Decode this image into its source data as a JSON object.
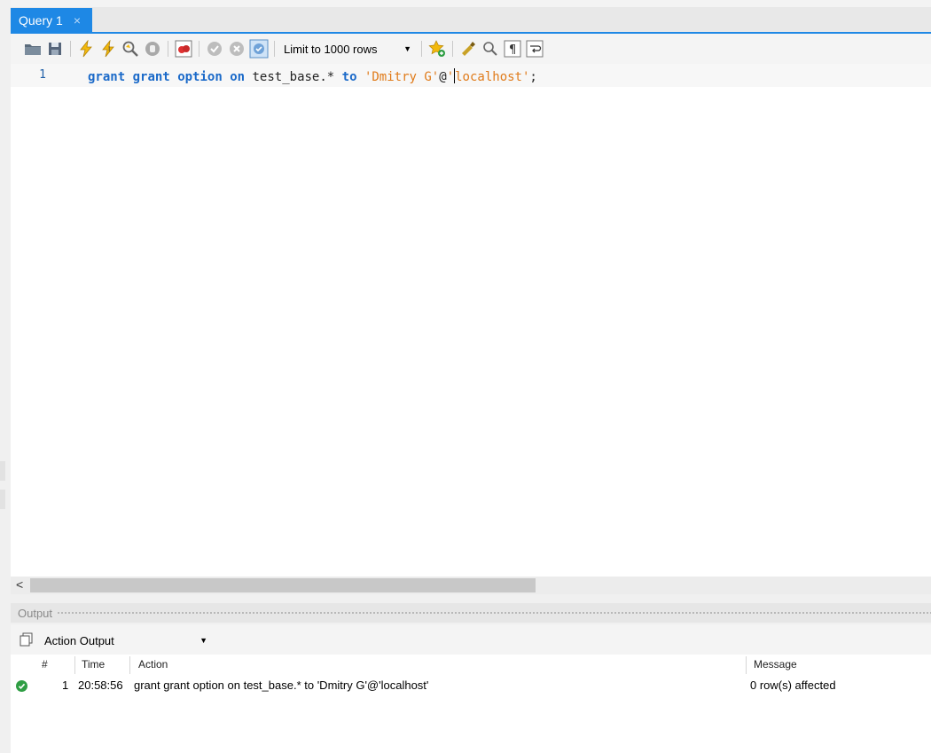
{
  "tabs": [
    {
      "label": "Query 1",
      "close": "×",
      "active": true
    }
  ],
  "toolbar": {
    "limit_select": {
      "value": "Limit to 1000 rows"
    }
  },
  "editor": {
    "line_number": "1",
    "tokens": {
      "t1": "grant",
      "t2": "grant",
      "t3": "option",
      "t4": "on",
      "t5": "test_base.*",
      "t6": "to",
      "t7": "'Dmitry G'",
      "t8": "@",
      "t9": "'",
      "t10": "localhost'",
      "t11": ";"
    }
  },
  "output": {
    "title": "Output",
    "view_select": {
      "value": "Action Output"
    },
    "columns": {
      "num": "#",
      "time": "Time",
      "action": "Action",
      "message": "Message"
    },
    "rows": [
      {
        "status": "success",
        "num": "1",
        "time": "20:58:56",
        "action": "grant grant option on test_base.* to 'Dmitry G'@'localhost'",
        "message": "0 row(s) affected"
      }
    ]
  },
  "colors": {
    "accent": "#1e88e5",
    "keyword": "#1b6ac9",
    "string": "#e07b1a",
    "success": "#2f9e44"
  }
}
